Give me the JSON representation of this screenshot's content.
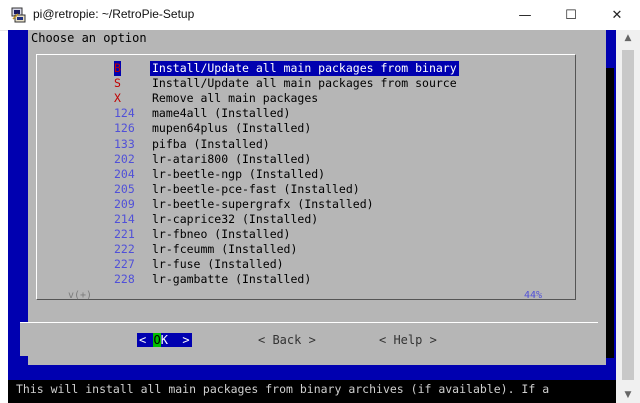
{
  "window": {
    "title": "pi@retropie: ~/RetroPie-Setup",
    "minimize": "—",
    "maximize": "☐",
    "close": "✕"
  },
  "dialog": {
    "title": "Choose an option",
    "items": [
      {
        "tag": "B",
        "label": "Install/Update all main packages from binary",
        "selected": true
      },
      {
        "tag": "S",
        "label": "Install/Update all main packages from source"
      },
      {
        "tag": "X",
        "label": "Remove all main packages"
      },
      {
        "tag": "124",
        "label": "mame4all (Installed)"
      },
      {
        "tag": "126",
        "label": "mupen64plus (Installed)"
      },
      {
        "tag": "133",
        "label": "pifba (Installed)"
      },
      {
        "tag": "202",
        "label": "lr-atari800 (Installed)"
      },
      {
        "tag": "204",
        "label": "lr-beetle-ngp (Installed)"
      },
      {
        "tag": "205",
        "label": "lr-beetle-pce-fast (Installed)"
      },
      {
        "tag": "209",
        "label": "lr-beetle-supergrafx (Installed)"
      },
      {
        "tag": "214",
        "label": "lr-caprice32 (Installed)"
      },
      {
        "tag": "221",
        "label": "lr-fbneo (Installed)"
      },
      {
        "tag": "222",
        "label": "lr-fceumm (Installed)"
      },
      {
        "tag": "227",
        "label": "lr-fuse (Installed)"
      },
      {
        "tag": "228",
        "label": "lr-gambatte (Installed)"
      }
    ],
    "scroll_indicator": "v(+)",
    "progress": "44%",
    "buttons": {
      "ok_left": "< ",
      "ok_hot": "O",
      "ok_rest": "K  >",
      "back": "< Back >",
      "help": "< Help >"
    }
  },
  "status_line": "This will install all main packages from binary archives (if available). If a",
  "colors": {
    "terminal_blue": "#0000b0",
    "dialog_gray": "#b6b6b6",
    "tag_blue": "#5050d8",
    "hotkey_red": "#c00000",
    "ok_hotkey_green": "#00c000"
  }
}
